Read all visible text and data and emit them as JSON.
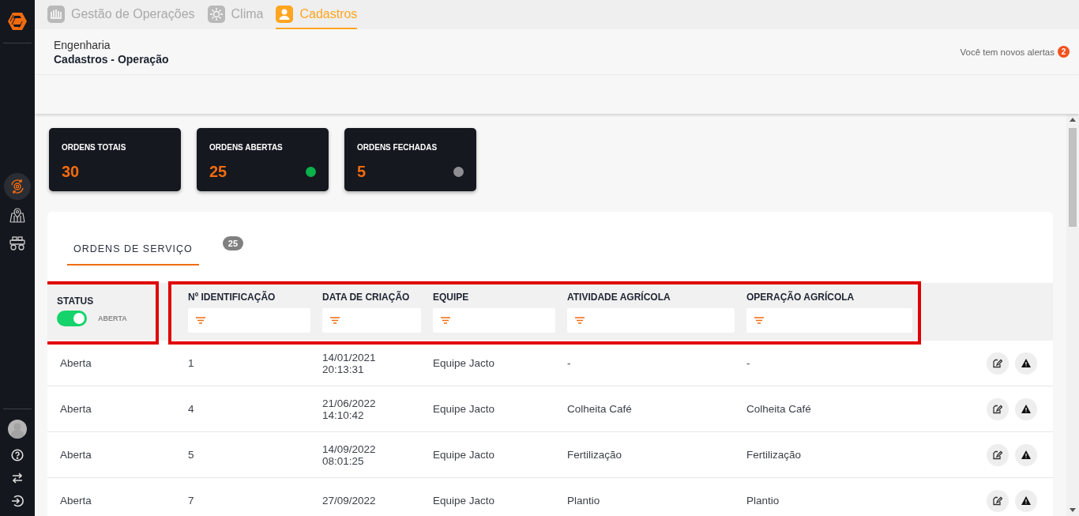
{
  "top_tabs": [
    {
      "label": "Gestão de Operações",
      "kind": "chart",
      "selected": false
    },
    {
      "label": "Clima",
      "kind": "sun",
      "selected": false
    },
    {
      "label": "Cadastros",
      "kind": "person",
      "selected": true
    }
  ],
  "sidebar": {
    "items": [
      {
        "kind": "operations",
        "selected": true
      },
      {
        "kind": "map",
        "selected": false
      },
      {
        "kind": "vehicle",
        "selected": false
      }
    ],
    "footer": [
      {
        "kind": "avatar"
      },
      {
        "kind": "help"
      },
      {
        "kind": "swap"
      },
      {
        "kind": "logout"
      }
    ]
  },
  "header": {
    "section": "Engenharia",
    "title": "Cadastros - Operação",
    "alerts_text": "Você tem novos alertas",
    "alerts_count": "2"
  },
  "stats": [
    {
      "label": "ORDENS TOTAIS",
      "value": "30"
    },
    {
      "label": "ORDENS ABERTAS",
      "value": "25",
      "color": "#0bb14b"
    },
    {
      "label": "ORDENS FECHADAS",
      "value": "5",
      "color": "#8e8e93"
    }
  ],
  "tabs": [
    {
      "label": "ORDENS DE SERVIÇO",
      "count": "25",
      "selected": true
    }
  ],
  "table": {
    "columns": [
      {
        "label": "STATUS",
        "kind": "toggle",
        "on": true,
        "value": "ABERTA"
      },
      {
        "label": "Nº IDENTIFICAÇÃO",
        "kind": "filter"
      },
      {
        "label": "DATA DE CRIAÇÃO",
        "kind": "filter"
      },
      {
        "label": "EQUIPE",
        "kind": "filter"
      },
      {
        "label": "ATIVIDADE AGRÍCOLA",
        "kind": "filter"
      },
      {
        "label": "OPERAÇÃO AGRÍCOLA",
        "kind": "filter"
      }
    ],
    "rows": [
      {
        "cells": [
          "Aberta",
          "1",
          "14/01/2021 20:13:31",
          "Equipe Jacto",
          "-",
          "-"
        ]
      },
      {
        "cells": [
          "Aberta",
          "4",
          "21/06/2022 14:10:42",
          "Equipe Jacto",
          "Colheita Café",
          "Colheita Café"
        ]
      },
      {
        "cells": [
          "Aberta",
          "5",
          "14/09/2022 08:01:25",
          "Equipe Jacto",
          "Fertilização",
          "Fertilização"
        ]
      },
      {
        "cells": [
          "Aberta",
          "7",
          "27/09/2022",
          "Equipe Jacto",
          "Plantio",
          "Plantio"
        ]
      }
    ]
  }
}
